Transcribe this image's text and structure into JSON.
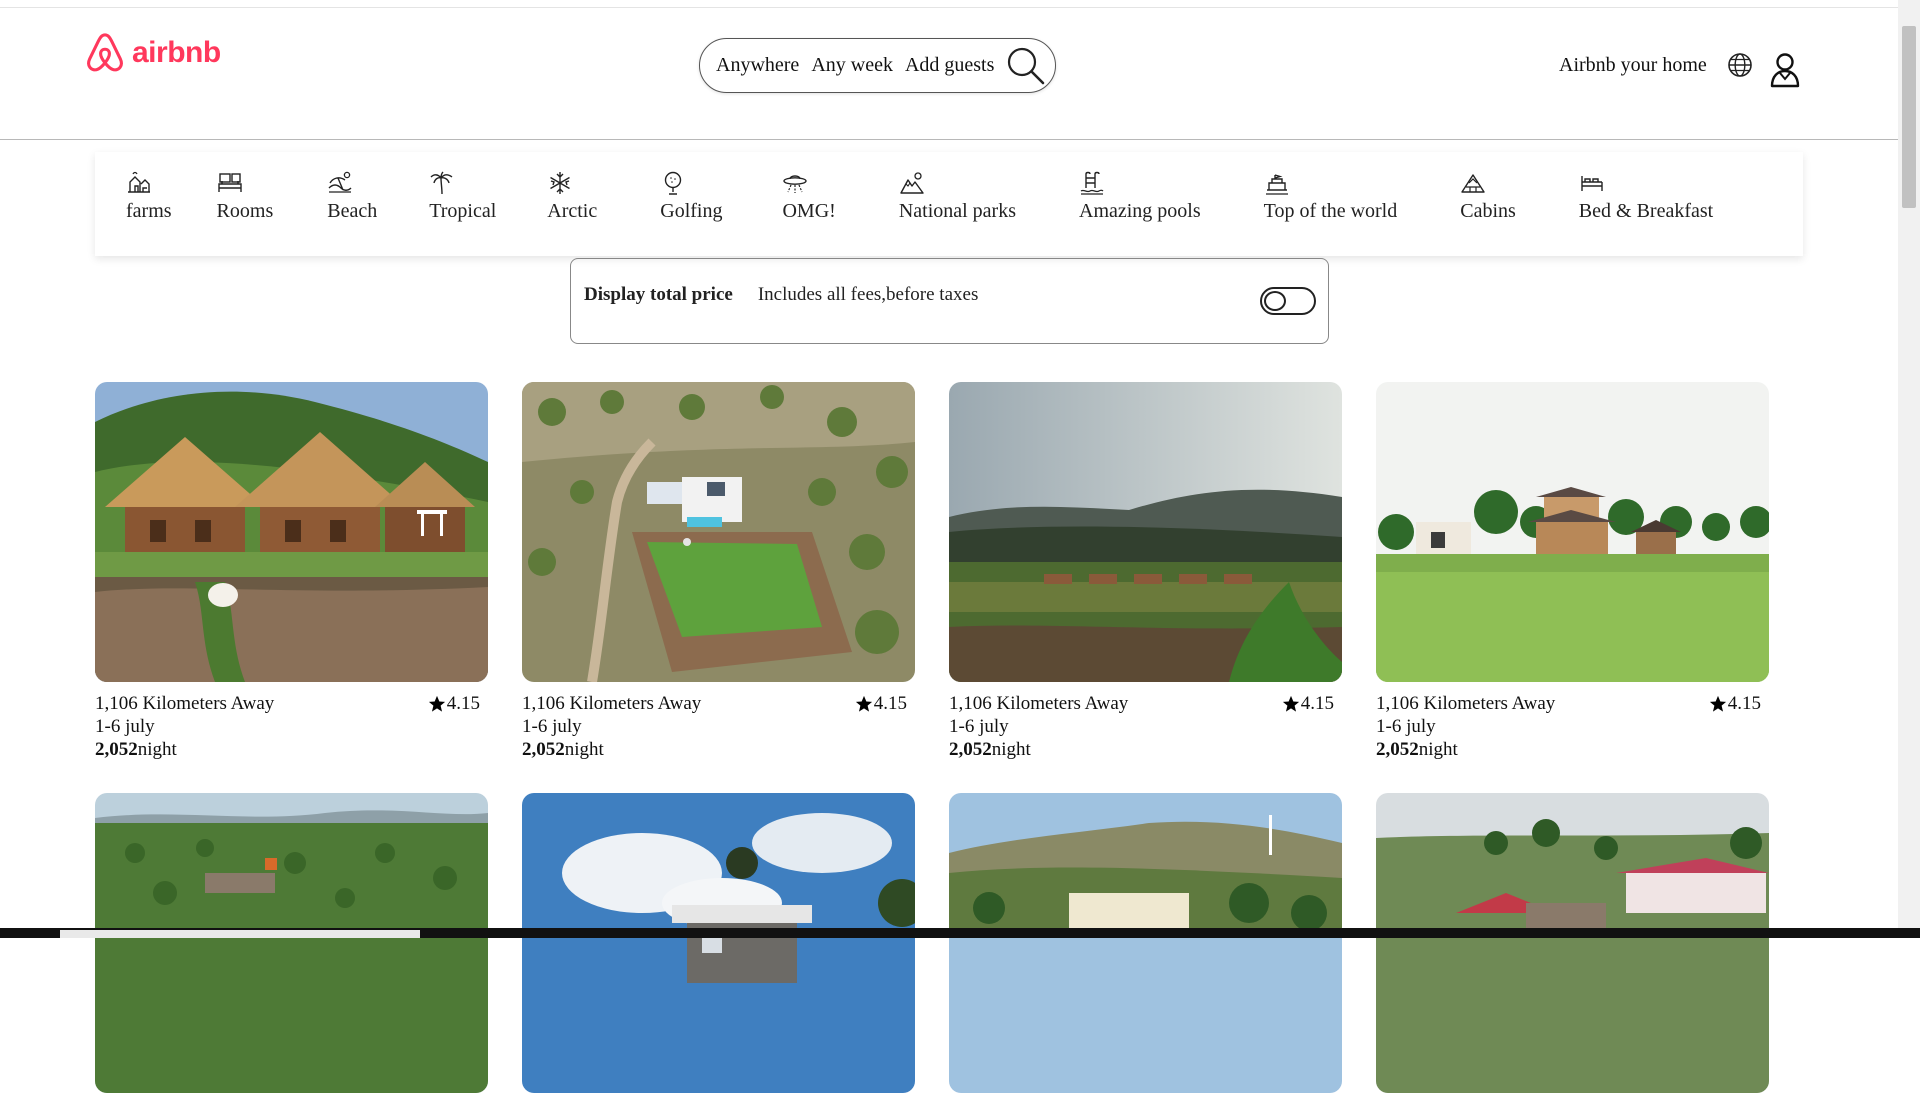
{
  "brand": {
    "name": "airbnb",
    "color": "#ff385c",
    "icon": "airbnb-belo-icon"
  },
  "search": {
    "where": "Anywhere",
    "when": "Any week",
    "who": "Add guests",
    "icon": "search-icon"
  },
  "nav": {
    "host_label": "Airbnb your home",
    "language_icon": "globe-icon",
    "account_icon": "user-icon"
  },
  "categories": [
    {
      "label": "farms",
      "icon": "farm-icon"
    },
    {
      "label": "Rooms",
      "icon": "rooms-icon"
    },
    {
      "label": "Beach",
      "icon": "beach-icon"
    },
    {
      "label": "Tropical",
      "icon": "palm-tree-icon"
    },
    {
      "label": "Arctic",
      "icon": "snowflake-icon"
    },
    {
      "label": "Golfing",
      "icon": "golf-icon"
    },
    {
      "label": "OMG!",
      "icon": "ufo-icon"
    },
    {
      "label": "National parks",
      "icon": "mountain-icon"
    },
    {
      "label": "Amazing pools",
      "icon": "pool-icon"
    },
    {
      "label": "Top of the world",
      "icon": "summit-icon"
    },
    {
      "label": "Cabins",
      "icon": "cabin-icon"
    },
    {
      "label": "Bed & Breakfast",
      "icon": "bed-icon"
    }
  ],
  "price_toggle": {
    "title": "Display total price",
    "subtitle": "Includes all fees,before taxes",
    "enabled": false
  },
  "listings": [
    {
      "distance": "1,106 Kilometers Away",
      "dates": "1-6 july",
      "price": "2,052",
      "unit": "night",
      "rating": "4.15"
    },
    {
      "distance": "1,106 Kilometers Away",
      "dates": "1-6 july",
      "price": "2,052",
      "unit": "night",
      "rating": "4.15"
    },
    {
      "distance": "1,106 Kilometers Away",
      "dates": "1-6 july",
      "price": "2,052",
      "unit": "night",
      "rating": "4.15"
    },
    {
      "distance": "1,106 Kilometers Away",
      "dates": "1-6 july",
      "price": "2,052",
      "unit": "night",
      "rating": "4.15"
    }
  ]
}
